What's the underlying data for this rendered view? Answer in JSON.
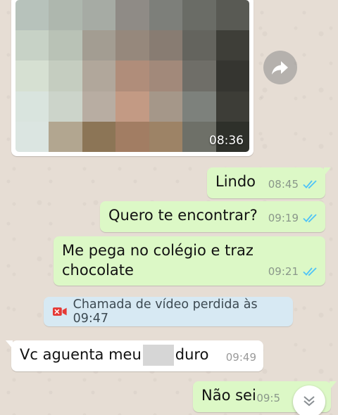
{
  "image_message": {
    "time": "08:36"
  },
  "messages": [
    {
      "text": "Lindo",
      "time": "08:45"
    },
    {
      "text": "Quero te encontrar?",
      "time": "09:19"
    },
    {
      "line1": "Me pega no colégio e traz",
      "line2": "chocolate",
      "time": "09:21"
    }
  ],
  "system_message": {
    "text": "Chamada de vídeo perdida às 09:47"
  },
  "incoming": {
    "text_before": "Vc aguenta meu",
    "text_after": "duro",
    "time": "09:49"
  },
  "last_outgoing": {
    "text": "Não sei",
    "time": "09:5"
  },
  "icons": {
    "forward": "forward-arrow-icon",
    "read_receipt": "double-check-icon",
    "missed_video_call": "missed-video-call-icon",
    "scroll_down": "chevron-down-icon"
  },
  "colors": {
    "outgoing_bubble": "#dcf8c6",
    "incoming_bubble": "#ffffff",
    "read_tick": "#4fc3f7",
    "missed_call": "#e53935",
    "system_bubble": "#d7e9f3"
  }
}
